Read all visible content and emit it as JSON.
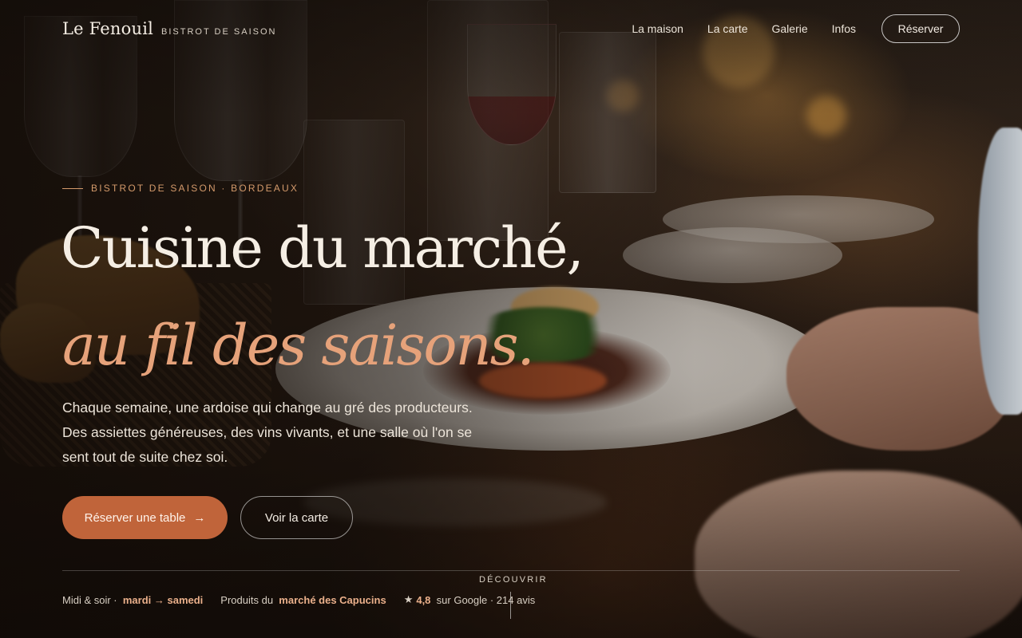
{
  "header": {
    "logo": "Le Fenouil",
    "tagline": "BISTROT DE SAISON",
    "nav": [
      "La maison",
      "La carte",
      "Galerie",
      "Infos"
    ],
    "reserve_label": "Réserver"
  },
  "hero": {
    "eyebrow": "BISTROT DE SAISON · BORDEAUX",
    "title_line1": "Cuisine du marché,",
    "title_line2": "au fil des saisons.",
    "description_lines": [
      "Chaque semaine, une ardoise qui change au gré des producteurs.",
      "Des assiettes généreuses, des vins vivants, et une salle où l'on se",
      "sent tout de suite chez soi."
    ],
    "cta_primary": "Réserver une table",
    "cta_primary_arrow": "→",
    "cta_secondary": "Voir la carte"
  },
  "footer": {
    "discover": "DÉCOUVRIR",
    "hours_prefix": "Midi & soir ·",
    "hours_days": "mardi → samedi",
    "products_prefix": "Produits du",
    "products_place": "marché des Capucins",
    "star_icon": "★",
    "rating": "4,8",
    "rating_suffix": "sur Google · 214 avis"
  },
  "colors": {
    "accent": "#c0643a",
    "accent_text": "#e6a27a",
    "eyebrow": "#d49a6b"
  }
}
